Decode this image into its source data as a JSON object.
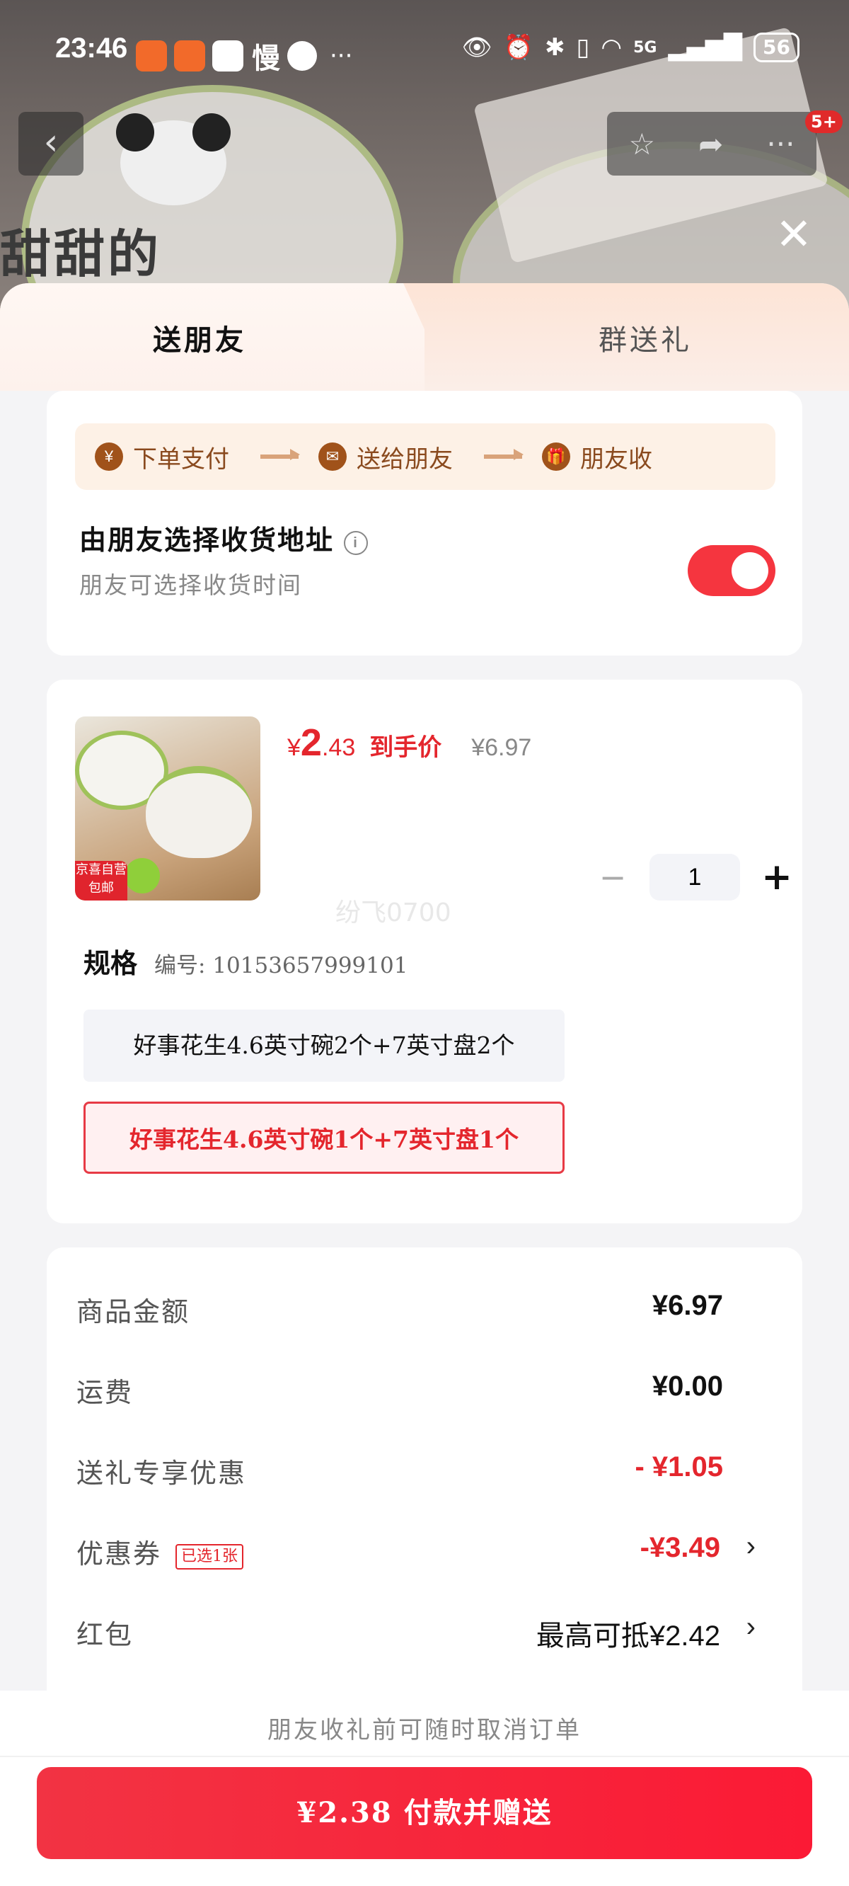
{
  "status": {
    "time": "23:46",
    "slow_label": "慢",
    "more_dots": "···",
    "network": "5G",
    "battery": "56"
  },
  "header": {
    "back_icon": "chevron-left-icon",
    "badge": "5+",
    "background_text": "甜甜的"
  },
  "tabs": [
    {
      "label": "送朋友",
      "active": true
    },
    {
      "label": "群送礼",
      "active": false
    }
  ],
  "steps": [
    {
      "icon": "¥",
      "label": "下单支付"
    },
    {
      "icon": "✉",
      "label": "送给朋友"
    },
    {
      "icon": "🎁",
      "label": "朋友收"
    }
  ],
  "address_option": {
    "title": "由朋友选择收货地址",
    "subtitle": "朋友可选择收货时间",
    "toggle_on": true
  },
  "product": {
    "thumb_tag": "京喜自营包邮",
    "price_currency": "¥",
    "price_int": "2",
    "price_dec": ".43",
    "price_label": "到手价",
    "original_price": "¥6.97",
    "quantity": "1",
    "watermark": "纷飞0700",
    "spec_title": "规格",
    "spec_number": "编号: 10153657999101",
    "options": [
      {
        "label": "好事花生4.6英寸碗2个+7英寸盘2个",
        "selected": false
      },
      {
        "label": "好事花生4.6英寸碗1个+7英寸盘1个",
        "selected": true
      }
    ]
  },
  "breakdown": {
    "goods_label": "商品金额",
    "goods_value": "¥6.97",
    "shipping_label": "运费",
    "shipping_value": "¥0.00",
    "gift_discount_label": "送礼专享优惠",
    "gift_discount_value": "- ¥1.05",
    "coupon_label": "优惠券",
    "coupon_tag": "已选1张",
    "coupon_value": "-¥3.49",
    "redpacket_label": "红包",
    "redpacket_value": "最高可抵¥2.42"
  },
  "bottom": {
    "note": "朋友收礼前可随时取消订单",
    "pay_label": "¥2.38 付款并赠送"
  },
  "colors": {
    "accent": "#e4262d",
    "button": "#f5333f",
    "step_bg": "#fdf1e6"
  }
}
